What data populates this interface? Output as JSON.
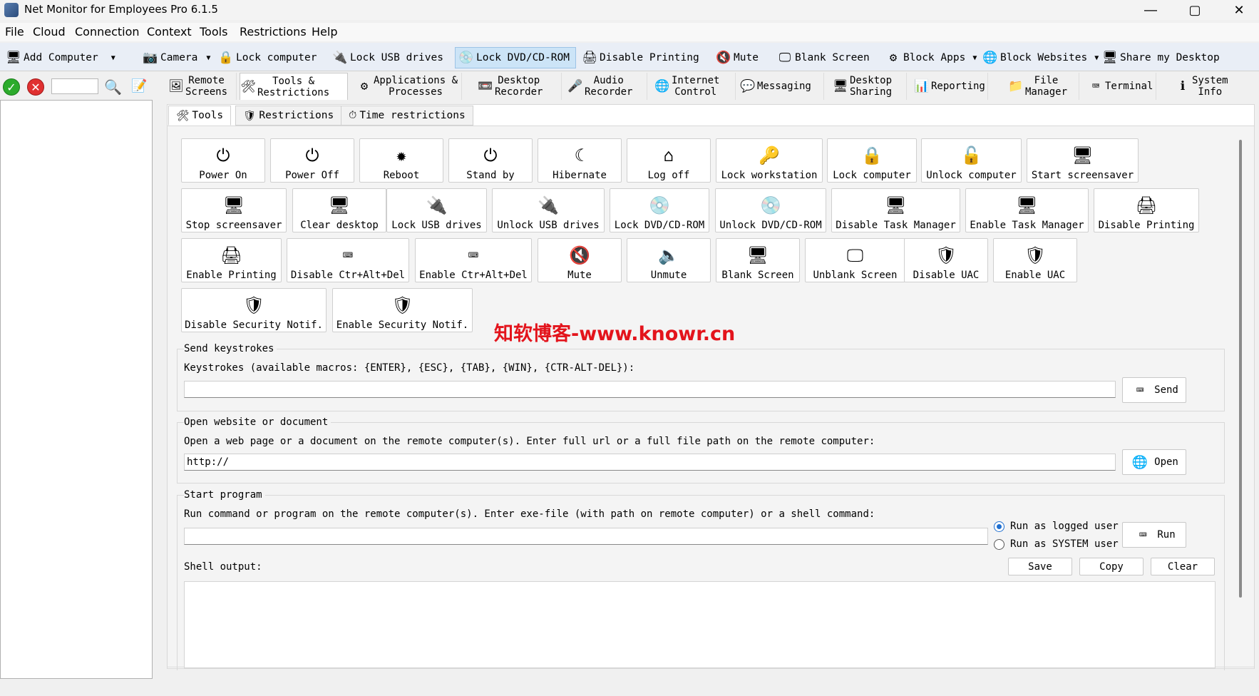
{
  "window": {
    "title": "Net Monitor for Employees Pro 6.1.5"
  },
  "menu": [
    "File",
    "Cloud",
    "Connection",
    "Context",
    "Tools",
    "Restrictions",
    "Help"
  ],
  "toolbar": [
    {
      "label": "Add Computer",
      "icon": "add-computer-icon"
    },
    {
      "label": "Camera",
      "icon": "camera-icon"
    },
    {
      "label": "Lock computer",
      "icon": "lock-icon"
    },
    {
      "label": "Lock USB drives",
      "icon": "usb-lock-icon"
    },
    {
      "label": "Lock DVD/CD-ROM",
      "icon": "dvd-lock-icon"
    },
    {
      "label": "Disable Printing",
      "icon": "printer-disable-icon"
    },
    {
      "label": "Mute",
      "icon": "mute-icon"
    },
    {
      "label": "Blank Screen",
      "icon": "monitor-icon"
    },
    {
      "label": "Block Apps",
      "icon": "block-apps-icon"
    },
    {
      "label": "Block Websites",
      "icon": "globe-icon"
    },
    {
      "label": "Share my Desktop",
      "icon": "share-desktop-icon"
    }
  ],
  "main_tabs": [
    {
      "label": "Remote\nScreens"
    },
    {
      "label": "Tools &\nRestrictions"
    },
    {
      "label": "Applications &\nProcesses"
    },
    {
      "label": "Desktop\nRecorder"
    },
    {
      "label": "Audio\nRecorder"
    },
    {
      "label": "Internet\nControl"
    },
    {
      "label": "Messaging"
    },
    {
      "label": "Desktop\nSharing"
    },
    {
      "label": "Reporting"
    },
    {
      "label": "File\nManager"
    },
    {
      "label": "Terminal"
    },
    {
      "label": "System\nInfo"
    }
  ],
  "sub_tabs": [
    "Tools",
    "Restrictions",
    "Time restrictions"
  ],
  "tools": [
    "Power On",
    "Power Off",
    "Reboot",
    "Stand by",
    "Hibernate",
    "Log off",
    "Lock workstation",
    "Lock computer",
    "Unlock computer",
    "Start screensaver",
    "Stop screensaver",
    "Clear desktop",
    "Lock USB drives",
    "Unlock USB drives",
    "Lock DVD/CD-ROM",
    "Unlock DVD/CD-ROM",
    "Disable Task Manager",
    "Enable Task Manager",
    "Disable Printing",
    "Enable Printing",
    "Disable Ctr+Alt+Del",
    "Enable Ctr+Alt+Del",
    "Mute",
    "Unmute",
    "Blank Screen",
    "Unblank Screen",
    "Disable UAC",
    "Enable UAC",
    "Disable Security Notif.",
    "Enable Security Notif."
  ],
  "send_keystrokes": {
    "title": "Send keystrokes",
    "desc": "Keystrokes (available macros: {ENTER}, {ESC}, {TAB}, {WIN}, {CTR-ALT-DEL}):",
    "value": "",
    "button": "Send"
  },
  "open_website": {
    "title": "Open website or document",
    "desc": "Open a web page or a document on the remote computer(s). Enter full url or a full file path on the remote computer:",
    "value": "http://",
    "button": "Open"
  },
  "start_program": {
    "title": "Start program",
    "desc": "Run command or program on the remote computer(s). Enter exe-file (with path on remote computer) or a shell command:",
    "value": "",
    "radio_logged": "Run as logged user",
    "radio_system": "Run as SYSTEM user",
    "button": "Run",
    "shell_label": "Shell output:",
    "save": "Save",
    "copy": "Copy",
    "clear": "Clear"
  },
  "watermark": "知软博客-www.knowr.cn"
}
